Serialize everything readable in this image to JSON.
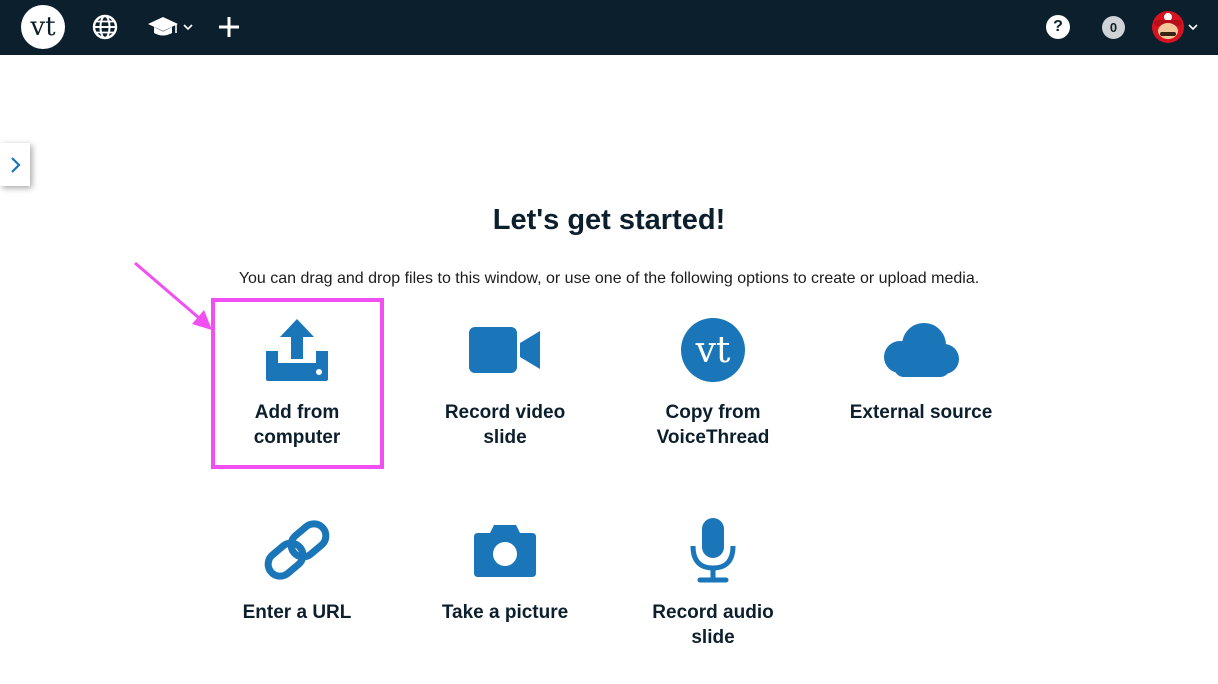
{
  "header": {
    "logo_text": "vt",
    "notification_count": "0",
    "help_symbol": "?"
  },
  "main": {
    "heading": "Let's get started!",
    "subtext": "You can drag and drop files to this window, or use one of the following options to create or upload media.",
    "options": [
      {
        "label_line1": "Add from",
        "label_line2": "computer",
        "icon": "upload-icon"
      },
      {
        "label_line1": "Record video",
        "label_line2": "slide",
        "icon": "video-camera-icon"
      },
      {
        "label_line1": "Copy from",
        "label_line2": "VoiceThread",
        "icon": "voicethread-icon"
      },
      {
        "label_line1": "External source",
        "label_line2": "",
        "icon": "cloud-icon"
      },
      {
        "label_line1": "Enter a URL",
        "label_line2": "",
        "icon": "link-icon"
      },
      {
        "label_line1": "Take a picture",
        "label_line2": "",
        "icon": "camera-icon"
      },
      {
        "label_line1": "Record audio",
        "label_line2": "slide",
        "icon": "microphone-icon"
      }
    ]
  },
  "colors": {
    "topbar": "#0c1f2c",
    "icon_blue": "#1a76b8",
    "highlight": "#f24ff2"
  }
}
